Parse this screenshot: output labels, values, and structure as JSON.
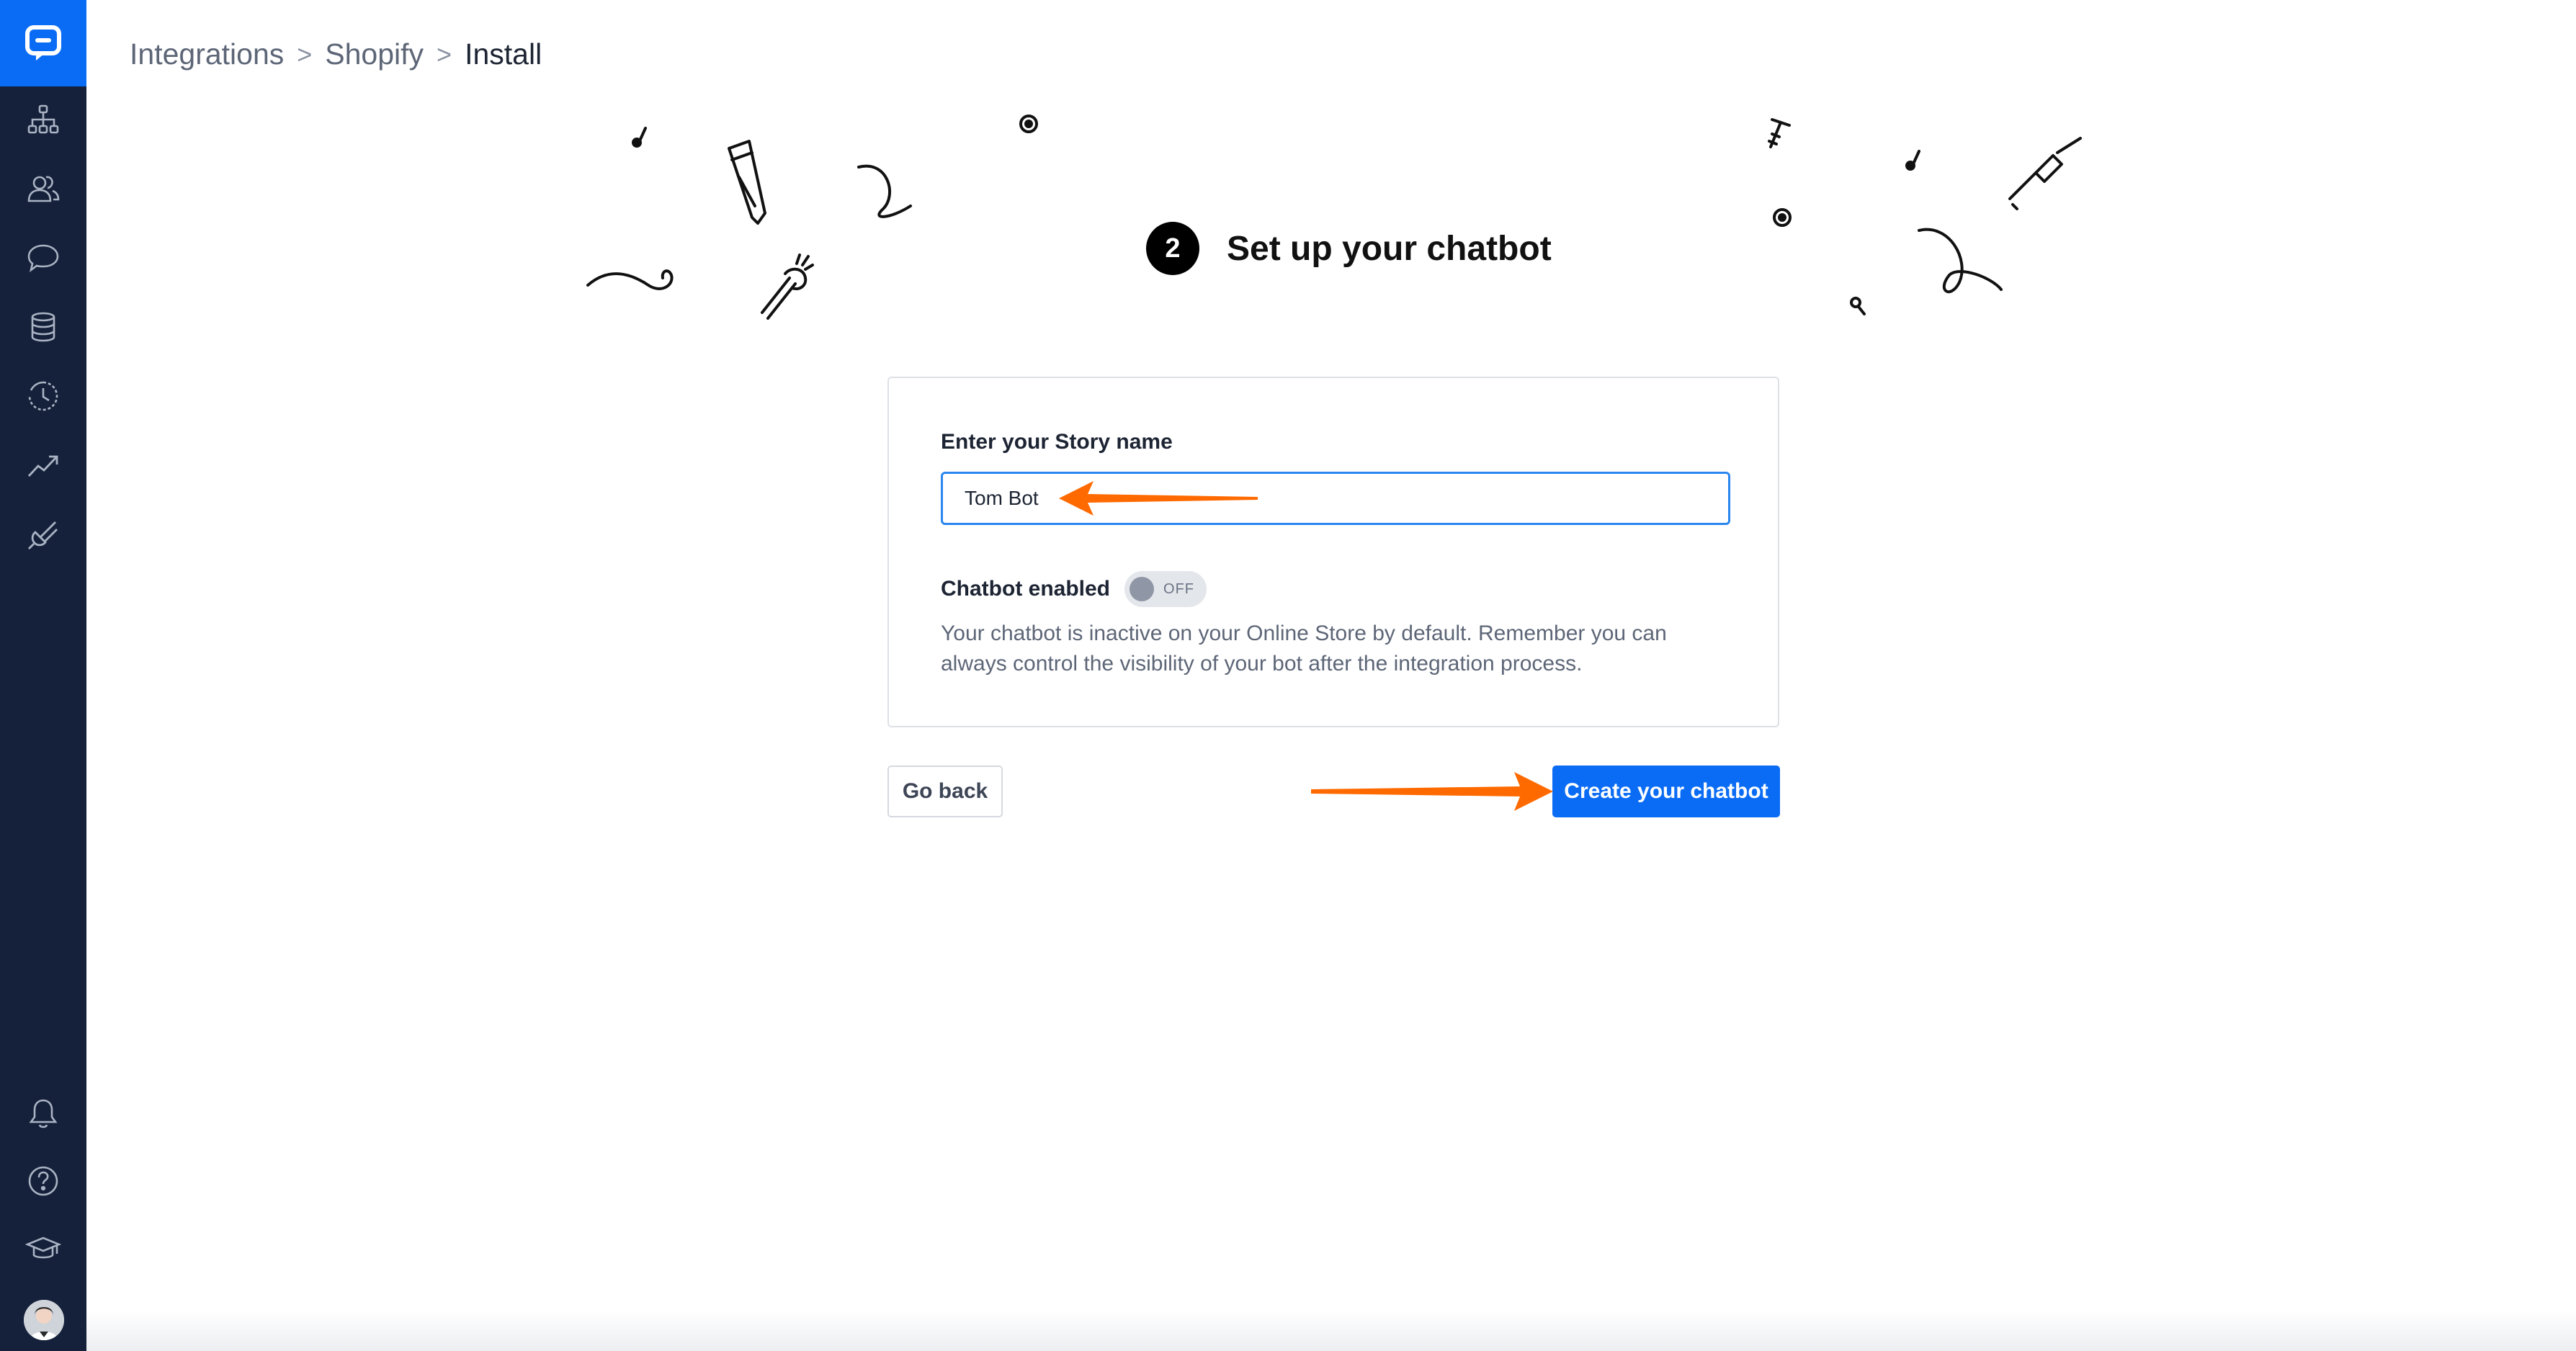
{
  "sidebar": {
    "logo": "chat-bubble-logo-icon",
    "items": [
      {
        "icon": "sitemap-icon"
      },
      {
        "icon": "users-icon"
      },
      {
        "icon": "chat-icon"
      },
      {
        "icon": "database-icon"
      },
      {
        "icon": "history-icon"
      },
      {
        "icon": "analytics-icon"
      },
      {
        "icon": "plug-icon"
      }
    ],
    "bottom_items": [
      {
        "icon": "bell-icon"
      },
      {
        "icon": "help-icon"
      },
      {
        "icon": "academy-icon"
      }
    ]
  },
  "breadcrumb": {
    "items": [
      "Integrations",
      "Shopify"
    ],
    "current": "Install",
    "separator": ">"
  },
  "step": {
    "number": "2",
    "title": "Set up your chatbot"
  },
  "form": {
    "story_label": "Enter your Story name",
    "story_value": "Tom Bot",
    "toggle_label": "Chatbot enabled",
    "toggle_state": "OFF",
    "help_text": "Your chatbot is inactive on your Online Store by default. Remember you can always control the visibility of your bot after the integration process."
  },
  "actions": {
    "back_label": "Go back",
    "create_label": "Create your chatbot"
  },
  "colors": {
    "sidebar_bg": "#15213a",
    "accent": "#0a6cf5",
    "annotation_arrow": "#ff6a00"
  }
}
